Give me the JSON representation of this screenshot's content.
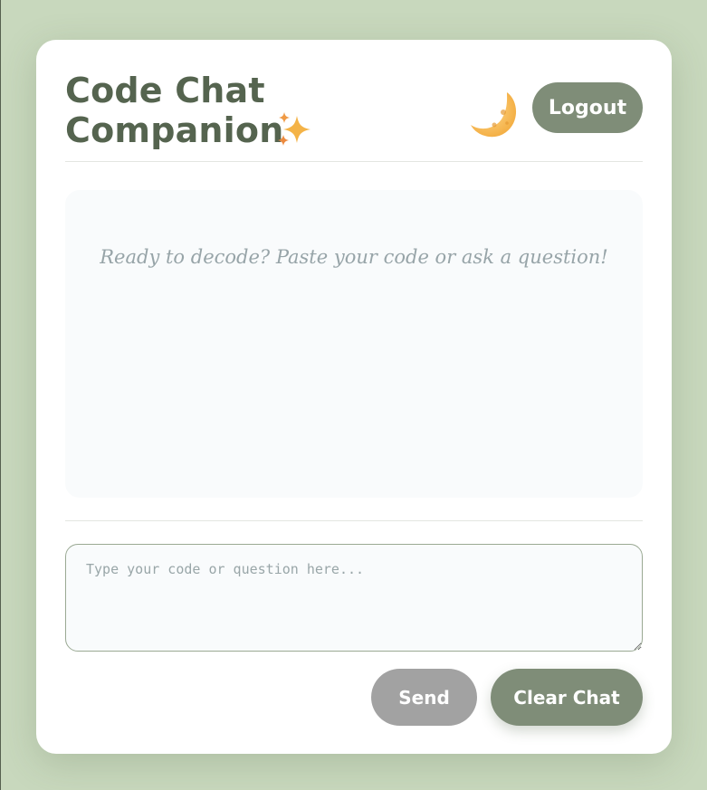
{
  "header": {
    "title_line1": "Code Chat",
    "title_line2": "Companion",
    "sparkle_icon": "sparkles-icon",
    "theme_toggle_icon": "crescent-moon-icon",
    "logout_label": "Logout"
  },
  "chat": {
    "empty_message": "Ready to decode? Paste your code or ask a question!"
  },
  "composer": {
    "placeholder": "Type your code or question here...",
    "value": "",
    "send_label": "Send",
    "clear_label": "Clear Chat"
  },
  "colors": {
    "page_background": "#c8d8bd",
    "accent": "#7f8d78",
    "title": "#55644f",
    "send_disabled": "#a2a2a2",
    "chat_background": "#f9fbfc"
  }
}
